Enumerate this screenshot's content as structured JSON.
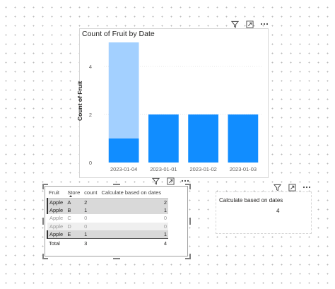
{
  "chart_visual": {
    "title": "Count of Fruit by Date",
    "icons": [
      "filter-icon",
      "focus-mode-icon",
      "more-options-icon"
    ]
  },
  "chart_data": {
    "type": "bar",
    "title": "Count of Fruit by Date",
    "xlabel": "",
    "ylabel": "Count of Fruit",
    "categories": [
      "2023-01-04",
      "2023-01-01",
      "2023-01-02",
      "2023-01-03"
    ],
    "series": [
      {
        "values": [
          1,
          2,
          2,
          2
        ],
        "color": "#118dff"
      },
      {
        "values": [
          4,
          0,
          0,
          0
        ],
        "color": "#a3d0ff"
      }
    ],
    "yticks": [
      "0",
      "2",
      "4"
    ],
    "ylim": [
      0,
      5
    ],
    "grid": true,
    "legend": "none"
  },
  "table_visual": {
    "icons": [
      "filter-icon",
      "focus-mode-icon",
      "more-options-icon"
    ],
    "columns": [
      "Fruit",
      "Store",
      "count",
      "Calculate based on dates"
    ],
    "rows": [
      {
        "fruit": "Apple",
        "store": "A",
        "count": "2",
        "calc": "2",
        "state": "selected"
      },
      {
        "fruit": "Apple",
        "store": "B",
        "count": "1",
        "calc": "1",
        "state": "selected"
      },
      {
        "fruit": "Apple",
        "store": "C",
        "count": "0",
        "calc": "0",
        "state": "dimmed"
      },
      {
        "fruit": "Apple",
        "store": "D",
        "count": "0",
        "calc": "0",
        "state": "dimmed"
      },
      {
        "fruit": "Apple",
        "store": "E",
        "count": "1",
        "calc": "1",
        "state": "selected"
      }
    ],
    "total": {
      "label": "Total",
      "count": "3",
      "calc": "4"
    }
  },
  "card_visual": {
    "title": "Calculate based on dates",
    "value": "4",
    "icons": [
      "filter-icon",
      "focus-mode-icon",
      "more-options-icon"
    ]
  },
  "colors": {
    "bar_highlight": "#118dff",
    "bar_base": "#a3d0ff",
    "selected_row": "#d9d9d9",
    "canvas_dots": "#b9b9b9"
  }
}
